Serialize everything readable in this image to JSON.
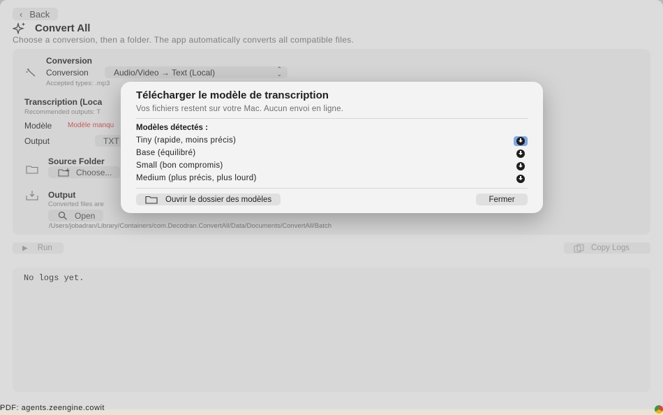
{
  "back": {
    "label": "Back"
  },
  "app": {
    "title": "Convert All",
    "subtitle": "Choose a conversion, then a folder. The app automatically converts all compatible files."
  },
  "conversion": {
    "section_title": "Conversion",
    "label": "Conversion",
    "selected": "Audio/Video → Text (Local)",
    "accepted": "Accepted types: .mp3"
  },
  "transcription": {
    "title": "Transcription (Loca",
    "recommended": "Recommended outputs: T",
    "model_label": "Modèle",
    "model_status": "Modèle manqu",
    "output_label": "Output",
    "output_value": "TXT"
  },
  "source": {
    "title": "Source Folder",
    "choose": "Choose..."
  },
  "output": {
    "title": "Output",
    "desc": "Converted files are",
    "open": "Open",
    "path": "/Users/jobadran/Library/Containers/com.Decodran.ConvertAll/Data/Documents/ConvertAll/Batch"
  },
  "actions": {
    "run": "Run",
    "copy_logs": "Copy Logs"
  },
  "log": {
    "text": "No logs yet."
  },
  "modal": {
    "title": "Télécharger le modèle de transcription",
    "subtitle": "Vos fichiers restent sur votre Mac. Aucun envoi en ligne.",
    "detected": "Modèles détectés :",
    "models": [
      {
        "name": "Tiny (rapide, moins précis)"
      },
      {
        "name": "Base (équilibré)"
      },
      {
        "name": "Small (bon compromis)"
      },
      {
        "name": "Medium (plus précis, plus lourd)"
      }
    ],
    "open_folder": "Ouvrir le dossier des modèles",
    "close": "Fermer"
  },
  "taskbar": {
    "text": "PDF: agents.zeengine.cowit"
  },
  "icons": [
    "chevron-left-icon",
    "sparkle-icon",
    "magic-wand-icon",
    "up-down-chevron-icon",
    "folder-icon",
    "tray-download-icon",
    "magnifier-icon",
    "play-icon",
    "copy-icon",
    "download-icon"
  ]
}
